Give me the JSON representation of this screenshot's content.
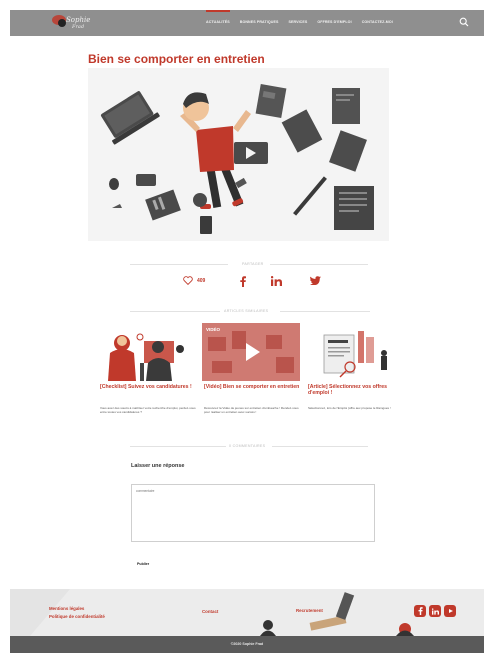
{
  "header": {
    "logo_text": "Sophie",
    "logo_subtext": "Frad",
    "nav": [
      "ACTUALITÉS",
      "BONNES PRATIQUES",
      "SERVICES",
      "OFFRES D'EMPLOI",
      "CONTACTEZ-MOI"
    ],
    "active_nav_index": 0
  },
  "article": {
    "title": "Bien se comporter en entretien",
    "image_alt": "Illustration of a man relaxing on the floor surrounded by office items"
  },
  "share": {
    "section_label": "Partager",
    "likes_count": "409"
  },
  "related": {
    "section_label": "Articles similaires",
    "cards": [
      {
        "title": "[Checklist] Suivez vos candidatures !",
        "text": "Vous avez des soucis à maîtriser votre recherche d'emploi, perdez-vous entre toutes vos candidatures ?"
      },
      {
        "title": "[Vidéo] Bien se comporter en entretien",
        "text": "Découvrez la Vidéo de jeunes sur entretien d'embauche ! Rendez-vous pour réaliser un entretien avec succès !",
        "image_label": "VIDÉO"
      },
      {
        "title": "[Article] Sélectionnez vos offres d'emploi !",
        "text": "Sélectionnez, lors de l'Emploi (offre aux propose le Ramgues !"
      }
    ]
  },
  "comments": {
    "section_label": "0 commentaires",
    "reply_title": "Laisser une réponse",
    "comment_placeholder": "commentaire",
    "submit_label": "Publier"
  },
  "footer": {
    "legal_link": "Mentions légales",
    "privacy_link": "Politique de confidentialité",
    "contact_link": "Contact",
    "recruiter_link": "Recrutement",
    "copyright": "©2020 Sophie Frad"
  },
  "colors": {
    "accent": "#c0392b",
    "header_bg": "#8f8f8f",
    "footer_bg": "#ececec",
    "bottom_bar": "#5a5a5a"
  },
  "icons": [
    "search-icon",
    "heart-icon",
    "facebook-icon",
    "linkedin-icon",
    "twitter-icon",
    "play-icon",
    "facebook-square-icon",
    "linkedin-square-icon",
    "youtube-icon"
  ]
}
